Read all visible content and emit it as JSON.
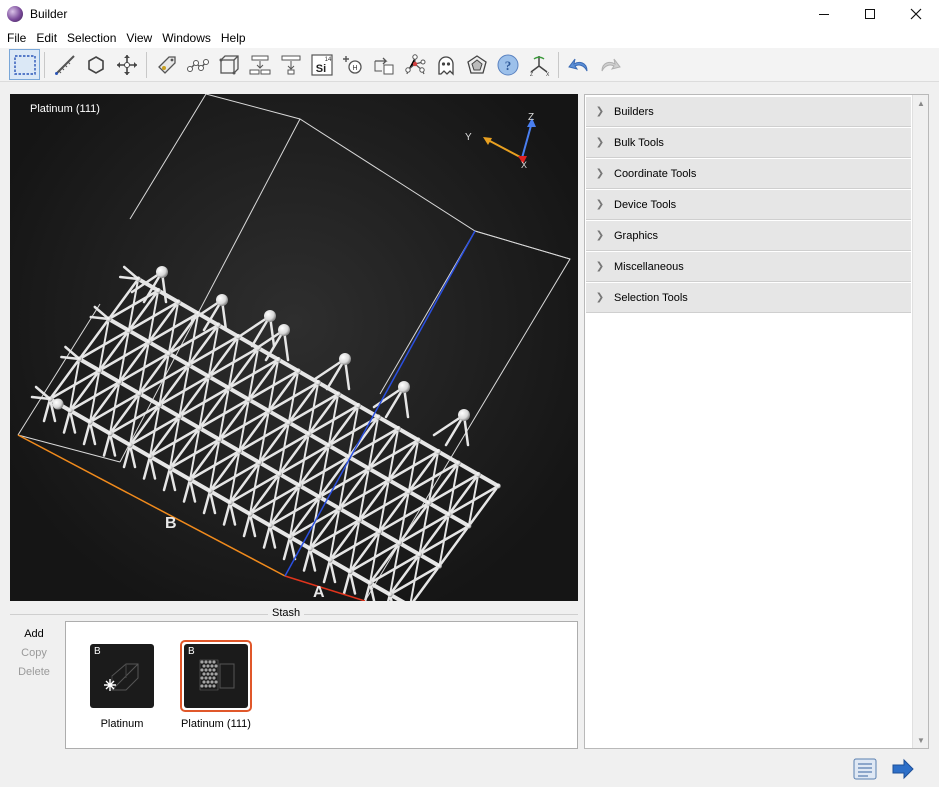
{
  "window": {
    "title": "Builder",
    "icon": "builder-app-icon"
  },
  "window_controls": {
    "minimize": "minimize-icon",
    "maximize": "maximize-icon",
    "close": "close-icon"
  },
  "menu": {
    "items": [
      "File",
      "Edit",
      "Selection",
      "View",
      "Windows",
      "Help"
    ]
  },
  "toolbar": {
    "tools": [
      {
        "name": "rectangle-select-icon",
        "active": true
      },
      {
        "name": "measure-icon"
      },
      {
        "name": "hexagon-icon"
      },
      {
        "name": "move-icon"
      },
      {
        "name": "tag-icon"
      },
      {
        "name": "bond-chain-icon"
      },
      {
        "name": "cube-frame-icon"
      },
      {
        "name": "layer-split-icon"
      },
      {
        "name": "layer-insert-icon"
      },
      {
        "name": "element-si-icon",
        "text": "Si",
        "superscript": "14"
      },
      {
        "name": "atom-add-icon"
      },
      {
        "name": "atom-translate-icon"
      },
      {
        "name": "molecule-network-icon"
      },
      {
        "name": "ghost-atom-icon"
      },
      {
        "name": "polyhedron-icon"
      },
      {
        "name": "help-lifebuoy-icon"
      },
      {
        "name": "axes-xyz-icon"
      },
      {
        "name": "undo-icon"
      },
      {
        "name": "redo-icon"
      }
    ]
  },
  "viewport": {
    "title": "Platinum (111)",
    "axis_labels": {
      "a": "A",
      "b": "B"
    },
    "triad": {
      "z": "Z",
      "y": "Y",
      "x": "X"
    },
    "colors": {
      "axis_a": "#e0341c",
      "axis_b": "#f08a1c",
      "axis_c": "#2a4fe0",
      "triad_z": "#4a7ff0",
      "triad_y": "#e8a020",
      "triad_x": "#e02020"
    }
  },
  "stash": {
    "title": "Stash",
    "actions": [
      {
        "label": "Add",
        "enabled": true
      },
      {
        "label": "Copy",
        "enabled": false
      },
      {
        "label": "Delete",
        "enabled": false
      }
    ],
    "items": [
      {
        "label": "Platinum",
        "badge": "B",
        "selected": false
      },
      {
        "label": "Platinum (111)",
        "badge": "B",
        "selected": true
      }
    ]
  },
  "right_panel": {
    "sections": [
      "Builders",
      "Bulk Tools",
      "Coordinate Tools",
      "Device Tools",
      "Graphics",
      "Miscellaneous",
      "Selection Tools"
    ]
  },
  "bottom_buttons": {
    "report": "report-icon",
    "next": "arrow-right-icon"
  }
}
